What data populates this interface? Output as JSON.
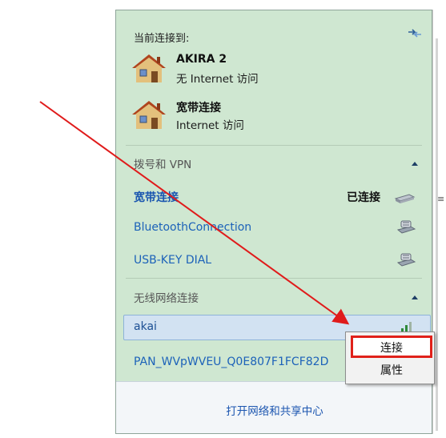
{
  "header": {
    "title": "当前连接到:"
  },
  "current_connections": [
    {
      "name": "AKIRA  2",
      "status": "无 Internet 访问"
    },
    {
      "name": "宽带连接",
      "status": "Internet 访问"
    }
  ],
  "dialup_section": {
    "label": "拨号和 VPN",
    "items": [
      {
        "name": "宽带连接",
        "status": "已连接",
        "icon": "modem-icon"
      },
      {
        "name": "BluetoothConnection",
        "icon": "dialup-phone-icon"
      },
      {
        "name": "USB-KEY DIAL",
        "icon": "dialup-phone-icon"
      }
    ]
  },
  "wireless_section": {
    "label": "无线网络连接",
    "items": [
      {
        "name": "akai",
        "icon": "wifi-signal-icon"
      },
      {
        "name": "PAN_WVpWVEU_Q0E807F1FCF82D"
      }
    ]
  },
  "footer": {
    "link": "打开网络和共享中心"
  },
  "context_menu": {
    "items": [
      "连接",
      "属性"
    ],
    "selected": "连接"
  },
  "colors": {
    "panel": "#cfe7d1",
    "link": "#1c62b9",
    "highlight_border": "#e0211a",
    "arrow": "#e01b1b"
  }
}
